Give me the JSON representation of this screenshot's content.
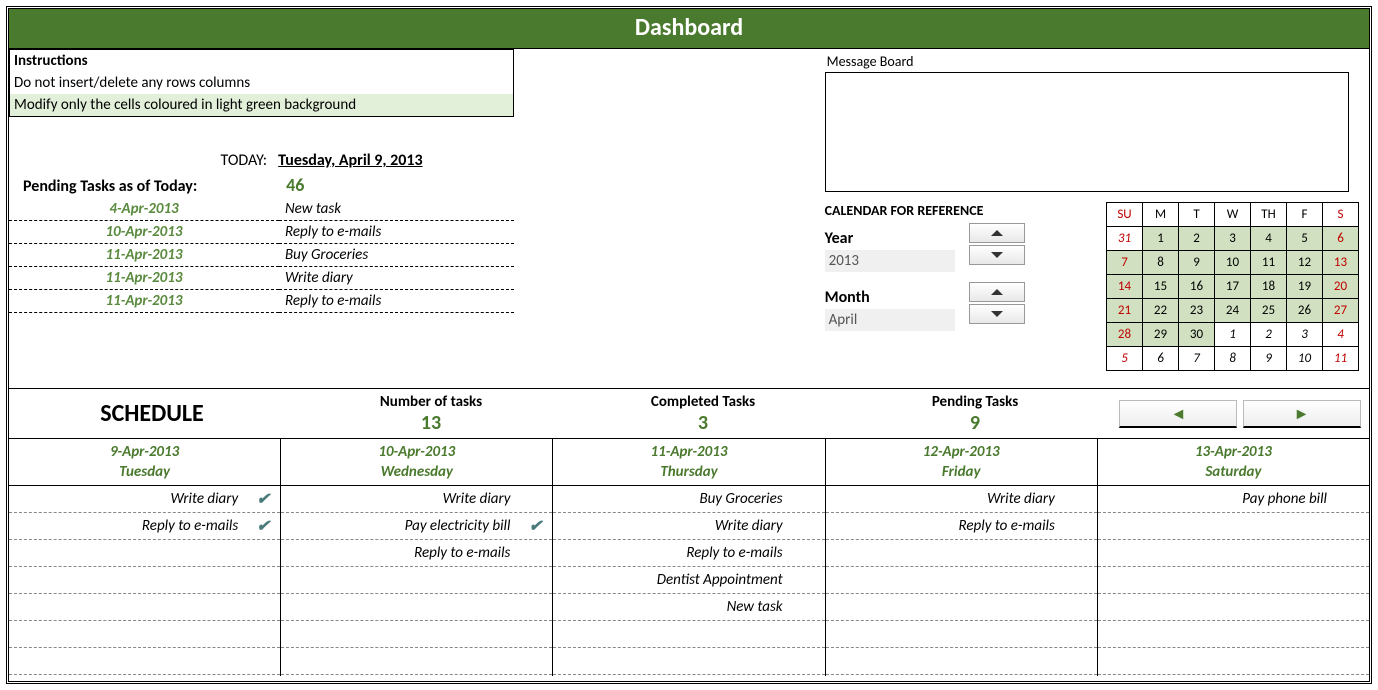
{
  "title": "Dashboard",
  "instructions": {
    "header": "Instructions",
    "line1": "Do not insert/delete any rows columns",
    "line2": "Modify only the cells coloured in light green background"
  },
  "today_label": "TODAY:",
  "today_value": "Tuesday, April 9, 2013",
  "pending_label": "Pending Tasks as of Today:",
  "pending_value": "46",
  "pending_list": [
    {
      "date": "4-Apr-2013",
      "name": "New task"
    },
    {
      "date": "10-Apr-2013",
      "name": "Reply to e-mails"
    },
    {
      "date": "11-Apr-2013",
      "name": "Buy Groceries"
    },
    {
      "date": "11-Apr-2013",
      "name": "Write diary"
    },
    {
      "date": "11-Apr-2013",
      "name": "Reply to e-mails"
    }
  ],
  "message_board_label": "Message Board",
  "calendar_ref": {
    "title": "CALENDAR FOR REFERENCE",
    "year_label": "Year",
    "year_value": "2013",
    "month_label": "Month",
    "month_value": "April",
    "weekdays": [
      "SU",
      "M",
      "T",
      "W",
      "TH",
      "F",
      "S"
    ],
    "grid": [
      [
        {
          "d": "31",
          "in": false
        },
        {
          "d": "1",
          "in": true
        },
        {
          "d": "2",
          "in": true
        },
        {
          "d": "3",
          "in": true
        },
        {
          "d": "4",
          "in": true
        },
        {
          "d": "5",
          "in": true
        },
        {
          "d": "6",
          "in": true
        }
      ],
      [
        {
          "d": "7",
          "in": true
        },
        {
          "d": "8",
          "in": true
        },
        {
          "d": "9",
          "in": true
        },
        {
          "d": "10",
          "in": true
        },
        {
          "d": "11",
          "in": true
        },
        {
          "d": "12",
          "in": true
        },
        {
          "d": "13",
          "in": true
        }
      ],
      [
        {
          "d": "14",
          "in": true
        },
        {
          "d": "15",
          "in": true
        },
        {
          "d": "16",
          "in": true
        },
        {
          "d": "17",
          "in": true
        },
        {
          "d": "18",
          "in": true
        },
        {
          "d": "19",
          "in": true
        },
        {
          "d": "20",
          "in": true
        }
      ],
      [
        {
          "d": "21",
          "in": true
        },
        {
          "d": "22",
          "in": true
        },
        {
          "d": "23",
          "in": true
        },
        {
          "d": "24",
          "in": true
        },
        {
          "d": "25",
          "in": true
        },
        {
          "d": "26",
          "in": true
        },
        {
          "d": "27",
          "in": true
        }
      ],
      [
        {
          "d": "28",
          "in": true
        },
        {
          "d": "29",
          "in": true
        },
        {
          "d": "30",
          "in": true
        },
        {
          "d": "1",
          "in": false
        },
        {
          "d": "2",
          "in": false
        },
        {
          "d": "3",
          "in": false
        },
        {
          "d": "4",
          "in": false
        }
      ],
      [
        {
          "d": "5",
          "in": false
        },
        {
          "d": "6",
          "in": false
        },
        {
          "d": "7",
          "in": false
        },
        {
          "d": "8",
          "in": false
        },
        {
          "d": "9",
          "in": false
        },
        {
          "d": "10",
          "in": false
        },
        {
          "d": "11",
          "in": false
        }
      ]
    ]
  },
  "schedule": {
    "title": "SCHEDULE",
    "stats": [
      {
        "label": "Number of tasks",
        "value": "13"
      },
      {
        "label": "Completed Tasks",
        "value": "3"
      },
      {
        "label": "Pending Tasks",
        "value": "9"
      }
    ],
    "nav": {
      "prev": "◄",
      "next": "►"
    },
    "days": [
      {
        "date": "9-Apr-2013",
        "dow": "Tuesday",
        "tasks": [
          {
            "t": "Write diary",
            "done": true
          },
          {
            "t": "Reply to e-mails",
            "done": true
          }
        ]
      },
      {
        "date": "10-Apr-2013",
        "dow": "Wednesday",
        "tasks": [
          {
            "t": "Write diary",
            "done": false
          },
          {
            "t": "Pay electricity bill",
            "done": true
          },
          {
            "t": "Reply to e-mails",
            "done": false
          }
        ]
      },
      {
        "date": "11-Apr-2013",
        "dow": "Thursday",
        "tasks": [
          {
            "t": "Buy Groceries",
            "done": false
          },
          {
            "t": "Write diary",
            "done": false
          },
          {
            "t": "Reply to e-mails",
            "done": false
          },
          {
            "t": "Dentist Appointment",
            "done": false
          },
          {
            "t": "New task",
            "done": false
          }
        ]
      },
      {
        "date": "12-Apr-2013",
        "dow": "Friday",
        "tasks": [
          {
            "t": "Write diary",
            "done": false
          },
          {
            "t": "Reply to e-mails",
            "done": false
          }
        ]
      },
      {
        "date": "13-Apr-2013",
        "dow": "Saturday",
        "tasks": [
          {
            "t": "Pay phone bill",
            "done": false
          }
        ]
      }
    ],
    "rows_per_day": 7
  },
  "icons": {
    "check": "✓✓"
  }
}
